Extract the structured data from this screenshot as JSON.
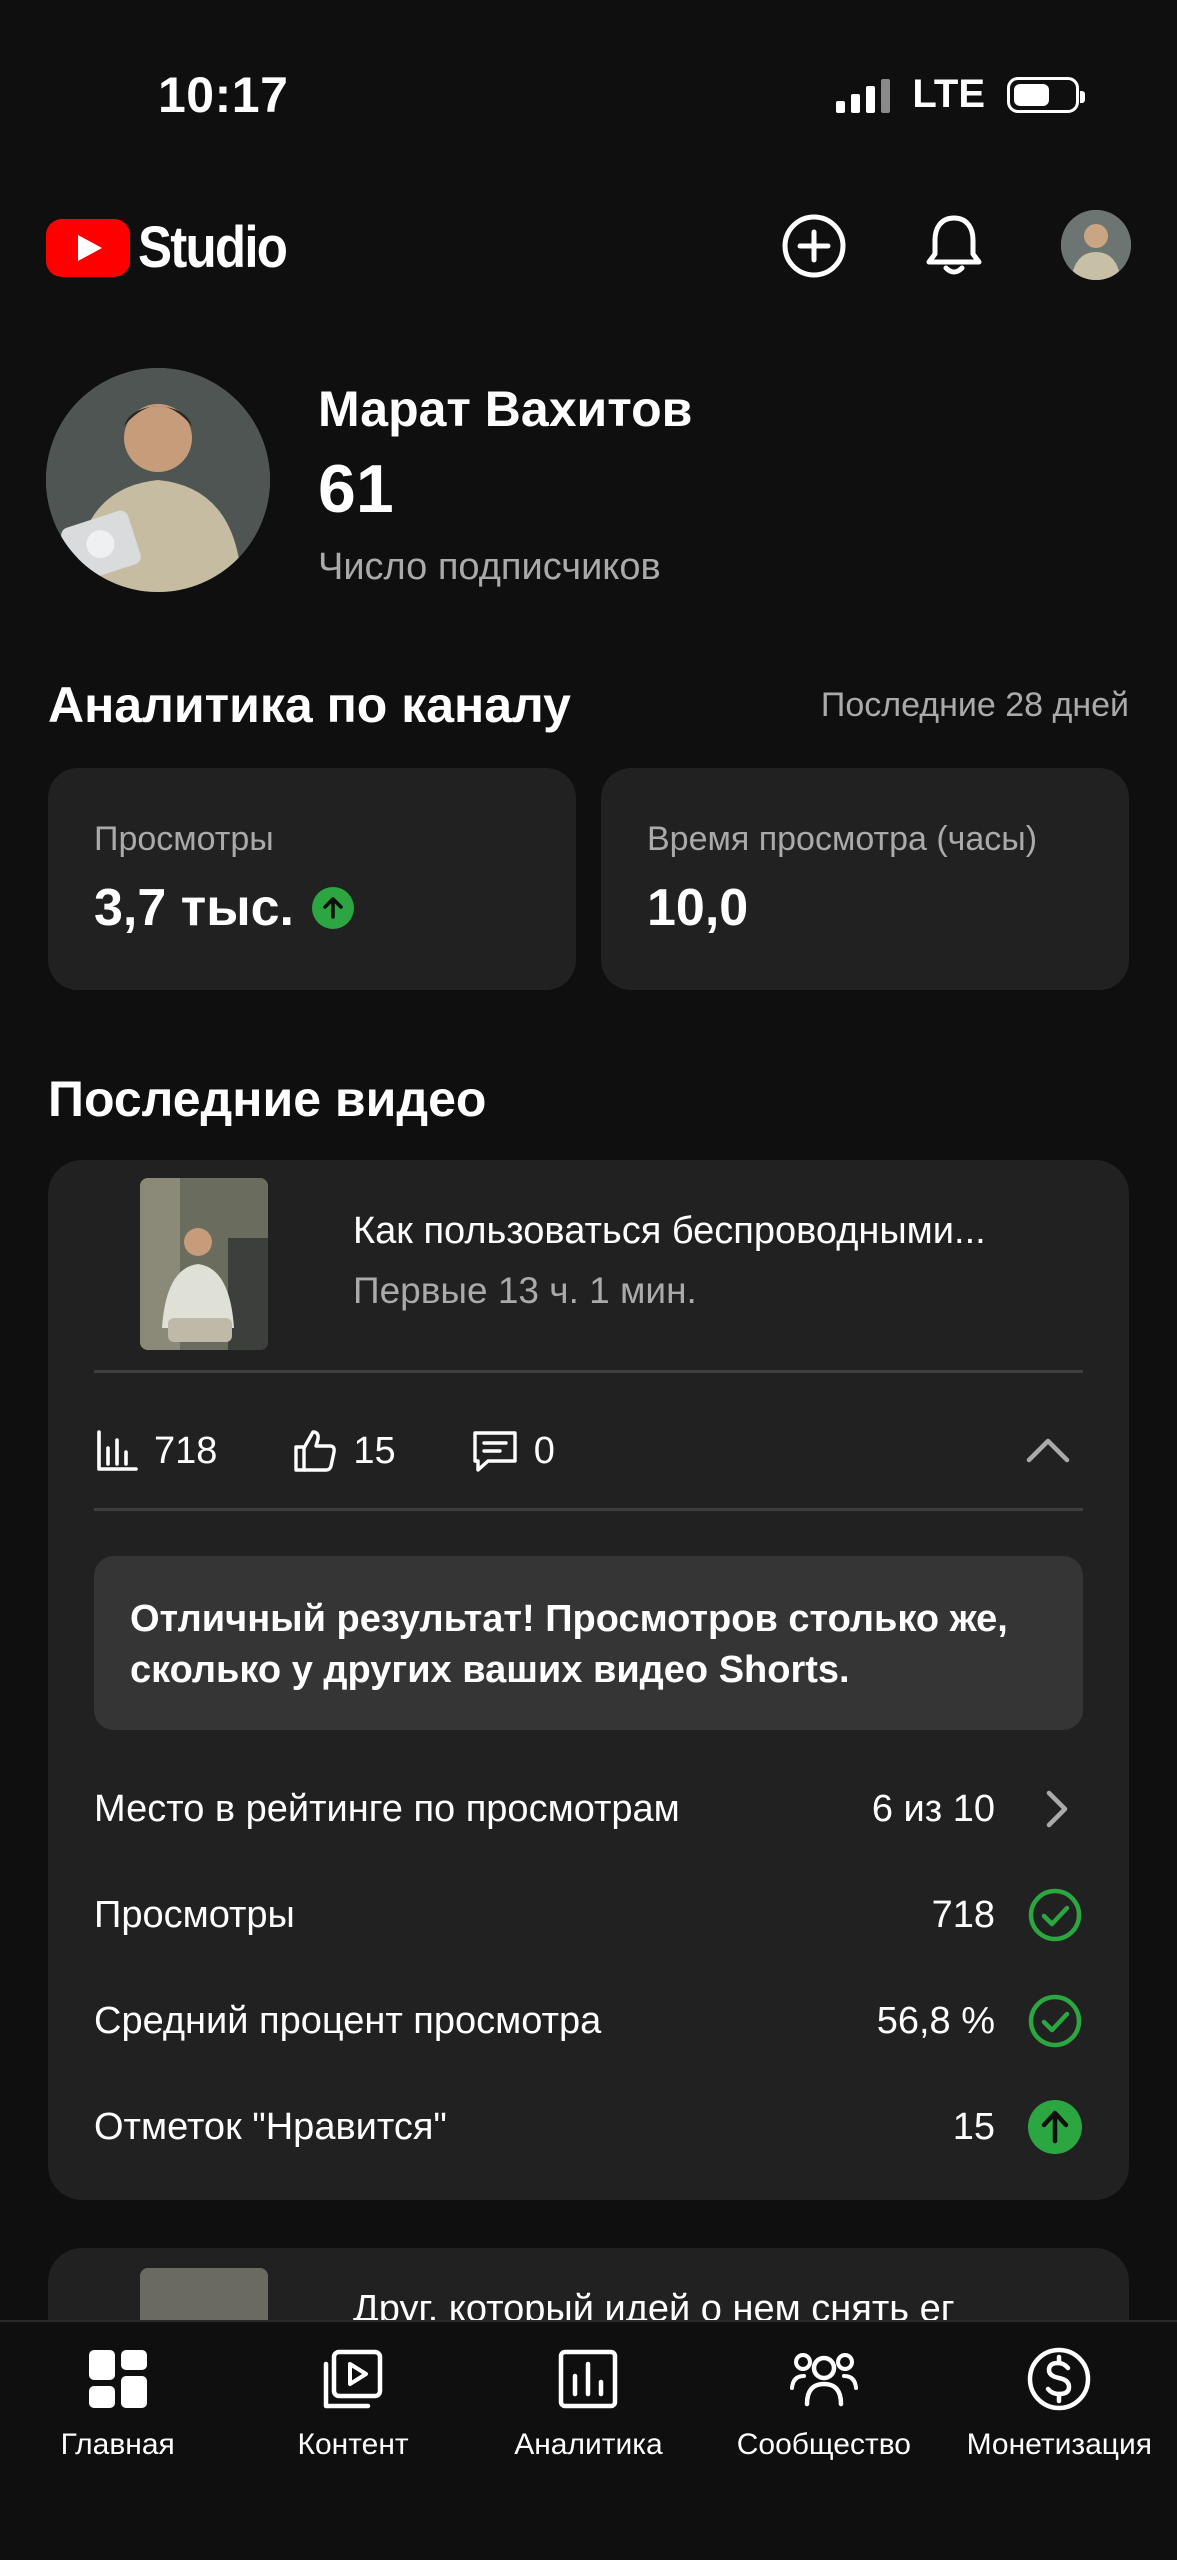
{
  "status_bar": {
    "time": "10:17",
    "network": "LTE",
    "battery_level": 0.6
  },
  "header": {
    "logo_text": "Studio",
    "icons": [
      "create-icon",
      "bell-icon",
      "avatar"
    ],
    "brand_color": "#ff0000"
  },
  "profile": {
    "name": "Марат Вахитов",
    "subscribers": "61",
    "subscribers_caption": "Число подписчиков"
  },
  "analytics": {
    "title": "Аналитика по каналу",
    "period": "Последние 28 дней",
    "views_label": "Просмотры",
    "views_value": "3,7 тыс.",
    "views_trend": "up",
    "watch_label": "Время просмотра (часы)",
    "watch_value": "10,0"
  },
  "recent": {
    "title": "Последние видео",
    "video": {
      "title": "Как пользоваться беспроводными...",
      "subtitle": "Первые 13 ч. 1 мин.",
      "views": "718",
      "likes": "15",
      "comments": "0",
      "insight": "Отличный результат! Просмотров столько же, сколько у других ваших видео Shorts.",
      "rows": [
        {
          "label": "Место в рейтинге по просмотрам",
          "value": "6 из 10",
          "icon": "chevron-right-icon"
        },
        {
          "label": "Просмотры",
          "value": "718",
          "icon": "check-circle-icon"
        },
        {
          "label": "Средний процент просмотра",
          "value": "56,8 %",
          "icon": "check-circle-icon"
        },
        {
          "label": "Отметок \"Нравится\"",
          "value": "15",
          "icon": "arrow-up-circle-icon"
        }
      ]
    },
    "next_video_title": "Друг, который идей о нем снять ег"
  },
  "nav": [
    {
      "label": "Главная",
      "icon": "home-icon"
    },
    {
      "label": "Контент",
      "icon": "content-icon"
    },
    {
      "label": "Аналитика",
      "icon": "analytics-icon"
    },
    {
      "label": "Сообщество",
      "icon": "community-icon"
    },
    {
      "label": "Монетизация",
      "icon": "monetization-icon"
    }
  ],
  "colors": {
    "background": "#0f0f0f",
    "card": "#212121",
    "positive": "#2ba640",
    "muted_text": "#aaaaaa"
  }
}
